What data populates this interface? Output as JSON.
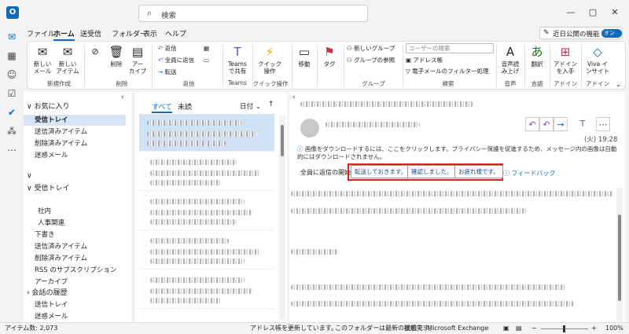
{
  "titlebar": {
    "app_icon": "O",
    "search_placeholder": "検索",
    "btn_min": "—",
    "btn_max": "▢",
    "btn_close": "✕"
  },
  "menu_tabs": [
    "ファイル",
    "ホーム",
    "送受信",
    "フォルダー",
    "表示",
    "ヘルプ"
  ],
  "active_tab": "ホーム",
  "preview_toggle": {
    "label": "近日公開の機能",
    "state": "オン"
  },
  "ribbon": {
    "new_mail": "新しい\nメール",
    "new_item": "新しい\nアイテム",
    "group_new": "新規作成",
    "delete": "削除",
    "archive": "アー\nカイブ",
    "group_delete": "削除",
    "reply": "返信",
    "reply_all": "全員に返信",
    "forward": "転送",
    "group_reply": "返信",
    "teams": "Teams\nで共有",
    "group_teams": "Teams",
    "quick_steps": "クイック\n操作",
    "group_quick": "クイック操作",
    "move": "移動",
    "tags": "タグ",
    "new_group": "新しいグループ",
    "browse_groups": "グループの参照",
    "group_groups": "グループ",
    "search_users_placeholder": "ユーザーの検索",
    "address_book": "アドレス帳",
    "filter_email": "電子メールのフィルター処理",
    "group_find": "検索",
    "read_aloud": "音声読\nみ上げ",
    "group_speech": "音声",
    "translate": "翻訳",
    "group_language": "言語",
    "get_addins": "アドイン\nを入手",
    "group_addins": "アドイン",
    "viva": "Viva イ\nンサイト",
    "group_addins2": "アドイン"
  },
  "folders": {
    "favorites_header": "お気に入り",
    "favorites": [
      "受信トレイ",
      "送信済みアイテム",
      "削除済みアイテム",
      "迷惑メール"
    ],
    "inbox_header": "受信トレイ",
    "subfolders": [
      "社内",
      "人事関連"
    ],
    "others": [
      "下書き",
      "送信済みアイテム",
      "削除済みアイテム",
      "RSS のサブスクリプション",
      "アーカイブ"
    ],
    "history": "会話の履歴",
    "more": [
      "送信トレイ",
      "迷惑メール"
    ]
  },
  "list": {
    "tab_all": "すべて",
    "tab_unread": "未読",
    "sort": "日付",
    "sort_dir": "↑"
  },
  "reading": {
    "date": "(火) 19:28",
    "info": "画像をダウンロードするには、ここをクリックします。プライバシー保護を促進するため、メッセージ内の画像は自動的にはダウンロードされません。",
    "reply_label": "全員に返信の開始:",
    "quick_replies": [
      "転送しておきます。",
      "確認しました。",
      "お疲れ様です。"
    ],
    "feedback": "フィードバック"
  },
  "status": {
    "items": "アイテム数: 2,073",
    "address_update": "アドレス帳を更新しています。",
    "folder_state": "このフォルダーは最新の状態です。",
    "connection": "接続先: Microsoft Exchange",
    "zoom": "100%"
  }
}
